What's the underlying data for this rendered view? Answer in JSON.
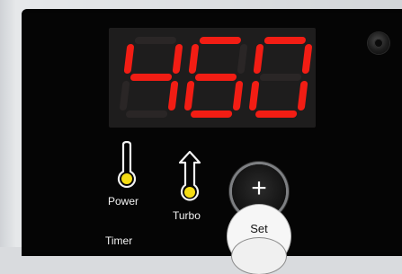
{
  "display": {
    "reading": "460",
    "segment_color": "#f21d14",
    "off_segment_color": "#2a2626"
  },
  "indicators": [
    {
      "label": "Power",
      "icon": "thermometer-icon",
      "led_color": "#f4dc14"
    },
    {
      "label": "Turbo",
      "icon": "thermometer-up-arrow-icon",
      "led_color": "#f4dc14"
    }
  ],
  "buttons": {
    "plus_label": "+",
    "set_label": "Set"
  },
  "timer_label": "Timer",
  "panel_color": "#050505"
}
